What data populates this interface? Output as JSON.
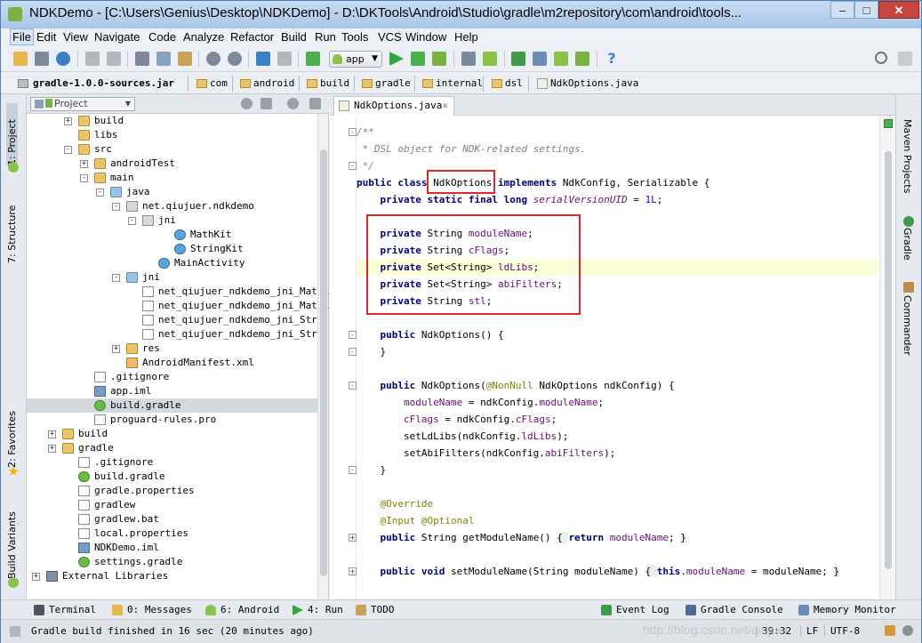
{
  "window": {
    "title": "NDKDemo - [C:\\Users\\Genius\\Desktop\\NDKDemo] - D:\\DKTools\\Android\\Studio\\gradle\\m2repository\\com\\android\\tools...",
    "min": "–",
    "max": "□",
    "close": "✕"
  },
  "menu": [
    "File",
    "Edit",
    "View",
    "Navigate",
    "Code",
    "Analyze",
    "Refactor",
    "Build",
    "Run",
    "Tools",
    "VCS",
    "Window",
    "Help"
  ],
  "toolbar": {
    "run_config": "app",
    "icons": [
      "open-icon",
      "save-icon",
      "sync-icon",
      "undo-icon",
      "redo-icon",
      "cut-icon",
      "copy-icon",
      "paste-icon",
      "find-icon",
      "replace-icon",
      "back-icon",
      "forward-icon",
      "make-icon",
      "run-icon",
      "debug-icon",
      "attach-icon",
      "profile-icon",
      "avd-icon",
      "sdk-icon",
      "sync-gradle-icon",
      "monitor-icon",
      "project-structure-icon",
      "help-icon",
      "search-icon"
    ]
  },
  "breadcrumb": [
    "gradle-1.0.0-sources.jar",
    "com",
    "android",
    "build",
    "gradle",
    "internal",
    "dsl",
    "NdkOptions.java"
  ],
  "left_strip": {
    "project": "1: Project",
    "structure": "7: Structure",
    "favorites": "2: Favorites",
    "build_variants": "Build Variants"
  },
  "right_strip": {
    "maven": "Maven Projects",
    "gradle": "Gradle",
    "commander": "Commander"
  },
  "project_panel": {
    "view": "Project",
    "tree": [
      {
        "label": "build",
        "icon": "folder",
        "exp": "+"
      },
      {
        "label": "libs",
        "icon": "folder",
        "exp": ""
      },
      {
        "label": "src",
        "icon": "folder",
        "exp": "-"
      },
      {
        "label": "androidTest",
        "icon": "folder",
        "exp": "+"
      },
      {
        "label": "main",
        "icon": "folder",
        "exp": "-"
      },
      {
        "label": "java",
        "icon": "src",
        "exp": "-"
      },
      {
        "label": "net.qiujuer.ndkdemo",
        "icon": "pkg",
        "exp": "-"
      },
      {
        "label": "jni",
        "icon": "pkg",
        "exp": "-"
      },
      {
        "label": "MathKit",
        "icon": "cls",
        "exp": ""
      },
      {
        "label": "StringKit",
        "icon": "cls",
        "exp": ""
      },
      {
        "label": "MainActivity",
        "icon": "cls",
        "exp": ""
      },
      {
        "label": "jni",
        "icon": "src",
        "exp": "-"
      },
      {
        "label": "net_qiujuer_ndkdemo_jni_MathKit.",
        "icon": "cfile",
        "exp": ""
      },
      {
        "label": "net_qiujuer_ndkdemo_jni_MathKit.l",
        "icon": "cfile",
        "exp": ""
      },
      {
        "label": "net_qiujuer_ndkdemo_jni_StringKi",
        "icon": "cfile",
        "exp": ""
      },
      {
        "label": "net_qiujuer_ndkdemo_jni_StringKi",
        "icon": "cfile",
        "exp": ""
      },
      {
        "label": "res",
        "icon": "folder",
        "exp": "+"
      },
      {
        "label": "AndroidManifest.xml",
        "icon": "xml",
        "exp": ""
      },
      {
        "label": ".gitignore",
        "icon": "file",
        "exp": ""
      },
      {
        "label": "app.iml",
        "icon": "iml",
        "exp": ""
      },
      {
        "label": "build.gradle",
        "icon": "gradle",
        "exp": ""
      },
      {
        "label": "proguard-rules.pro",
        "icon": "file",
        "exp": ""
      },
      {
        "label": "build",
        "icon": "folder",
        "exp": "+"
      },
      {
        "label": "gradle",
        "icon": "folder",
        "exp": "+"
      },
      {
        "label": ".gitignore",
        "icon": "file",
        "exp": ""
      },
      {
        "label": "build.gradle",
        "icon": "gradle",
        "exp": ""
      },
      {
        "label": "gradle.properties",
        "icon": "file",
        "exp": ""
      },
      {
        "label": "gradlew",
        "icon": "file",
        "exp": ""
      },
      {
        "label": "gradlew.bat",
        "icon": "file",
        "exp": ""
      },
      {
        "label": "local.properties",
        "icon": "file",
        "exp": ""
      },
      {
        "label": "NDKDemo.iml",
        "icon": "iml",
        "exp": ""
      },
      {
        "label": "settings.gradle",
        "icon": "gradle",
        "exp": ""
      },
      {
        "label": "External Libraries",
        "icon": "lib",
        "exp": "+"
      }
    ]
  },
  "editor": {
    "tab": "NdkOptions.java",
    "tab_close": "✕"
  },
  "bottom_tools": [
    {
      "label": "Terminal",
      "name": "terminal"
    },
    {
      "label": "0: Messages",
      "name": "messages"
    },
    {
      "label": "6: Android",
      "name": "android"
    },
    {
      "label": "4: Run",
      "name": "run"
    },
    {
      "label": "TODO",
      "name": "todo"
    },
    {
      "label": "Event Log",
      "name": "event-log"
    },
    {
      "label": "Gradle Console",
      "name": "gradle-console"
    },
    {
      "label": "Memory Monitor",
      "name": "memory-monitor"
    }
  ],
  "status": {
    "message": "Gradle build finished in 16 sec (20 minutes ago)",
    "position": "39:32",
    "line_sep": "LF",
    "encoding": "UTF-8"
  },
  "watermark": "http://blog.csdn.net/qiujuer"
}
